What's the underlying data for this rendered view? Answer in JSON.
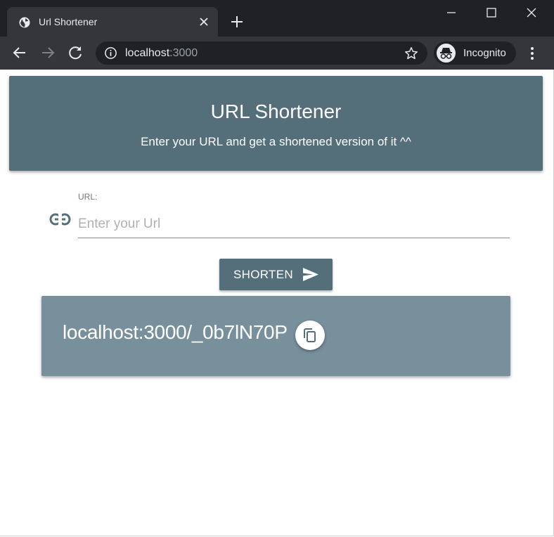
{
  "browser": {
    "tab": {
      "title": "Url Shortener",
      "favicon": "globe-icon"
    },
    "address": {
      "host": "localhost",
      "port": ":3000"
    },
    "profile": {
      "label": "Incognito",
      "icon": "incognito-icon"
    },
    "colors": {
      "frame": "#202124",
      "toolbar": "#35363a",
      "text": "#e8eaed"
    }
  },
  "header": {
    "title": "URL Shortener",
    "subtitle": "Enter your URL and get a shortened version of it ^^"
  },
  "form": {
    "url_label": "URL:",
    "url_placeholder": "Enter your Url",
    "url_value": "",
    "shorten_label": "SHORTEN"
  },
  "result": {
    "short_url": "localhost:3000/_0b7lN70P"
  },
  "colors": {
    "primary": "#546e7a",
    "result_bg": "#78909c",
    "on_primary": "#ffffff"
  }
}
